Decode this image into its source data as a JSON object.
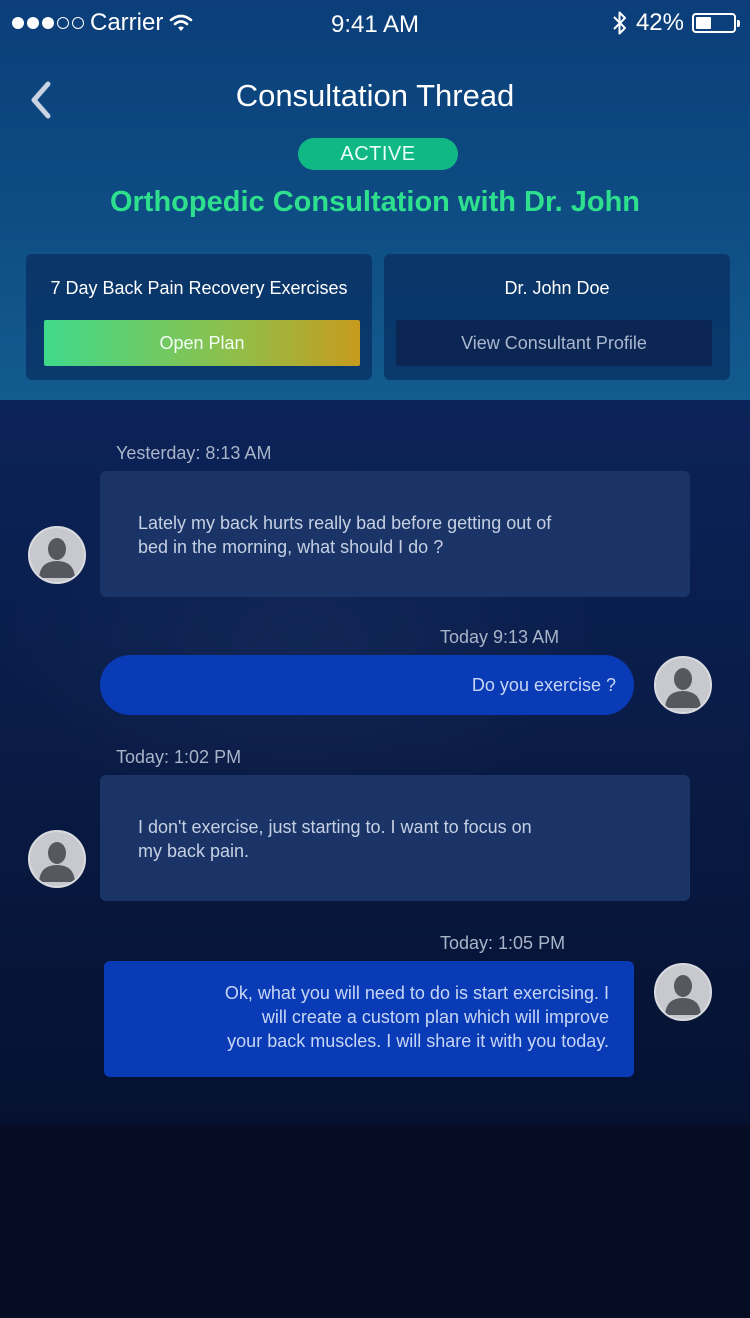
{
  "status_bar": {
    "carrier": "Carrier",
    "time": "9:41 AM",
    "battery": "42%",
    "battery_level": 0.42
  },
  "header": {
    "title": "Consultation Thread",
    "status_badge": "ACTIVE",
    "subtitle": "Orthopedic Consultation with Dr. John",
    "back_icon": "chevron-left-icon"
  },
  "cards": {
    "plan": {
      "label": "7 Day Back Pain Recovery Exercises",
      "button": "Open Plan"
    },
    "consultant": {
      "label": "Dr. John Doe",
      "button": "View Consultant Profile"
    }
  },
  "messages": [
    {
      "direction": "in",
      "timestamp": "Yesterday: 8:13 AM",
      "text_lines": [
        "Lately my back hurts really bad before getting out of",
        "bed in the morning, what should I do ?"
      ]
    },
    {
      "direction": "out",
      "timestamp": "Today 9:13 AM",
      "text_lines": [
        "Do you exercise ?"
      ]
    },
    {
      "direction": "in",
      "timestamp": "Today: 1:02 PM",
      "text_lines": [
        "I don't exercise, just starting to. I want to focus on",
        "my back pain."
      ]
    },
    {
      "direction": "out",
      "timestamp": "Today: 1:05 PM",
      "text_lines": [
        "Ok, what you will need to do is start exercising.  I",
        "will create a custom plan which will improve",
        "your back muscles. I will share it with you today."
      ]
    }
  ],
  "colors": {
    "accent_green": "#2ee08e",
    "badge_green": "#10b886",
    "outgoing_bubble": "#0a3bb6",
    "incoming_bubble": "#1a3468"
  }
}
